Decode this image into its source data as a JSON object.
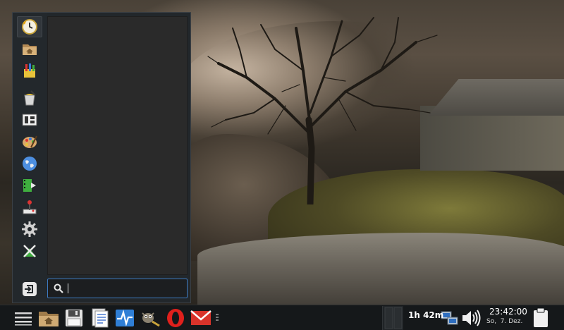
{
  "menu": {
    "favorites": [
      {
        "name": "recent-clock-icon"
      },
      {
        "name": "home-folder-icon"
      },
      {
        "name": "accessories-icon"
      },
      {
        "name": "paint-bucket-icon"
      },
      {
        "name": "office-icon"
      },
      {
        "name": "graphics-palette-icon"
      },
      {
        "name": "internet-globe-icon"
      },
      {
        "name": "multimedia-film-icon"
      },
      {
        "name": "games-joystick-icon"
      },
      {
        "name": "settings-gear-icon"
      },
      {
        "name": "system-tools-icon"
      }
    ],
    "logout_icon": "logout-icon",
    "search": {
      "value": "",
      "placeholder": ""
    }
  },
  "taskbar": {
    "launchers": [
      {
        "name": "app-menu-icon"
      },
      {
        "name": "file-manager-icon"
      },
      {
        "name": "save-disk-icon"
      },
      {
        "name": "document-editor-icon"
      },
      {
        "name": "system-monitor-icon"
      },
      {
        "name": "gimp-icon"
      },
      {
        "name": "opera-browser-icon"
      },
      {
        "name": "mail-icon"
      }
    ],
    "tray": {
      "battery_remaining": "1h 42m",
      "network_icon": "network-icon",
      "volume_icon": "volume-icon",
      "clipboard_icon": "clipboard-icon"
    },
    "clock": {
      "time": "23:42:00",
      "date": "So,  7. Dez."
    }
  },
  "colors": {
    "menu_bg": "#22272b",
    "list_bg": "#2a2a2a",
    "search_border": "#3d7ac0",
    "taskbar_bg": "#15181a",
    "opera_red": "#e0201c",
    "mail_red": "#d8332a",
    "monitor_blue": "#2f7fd6"
  }
}
